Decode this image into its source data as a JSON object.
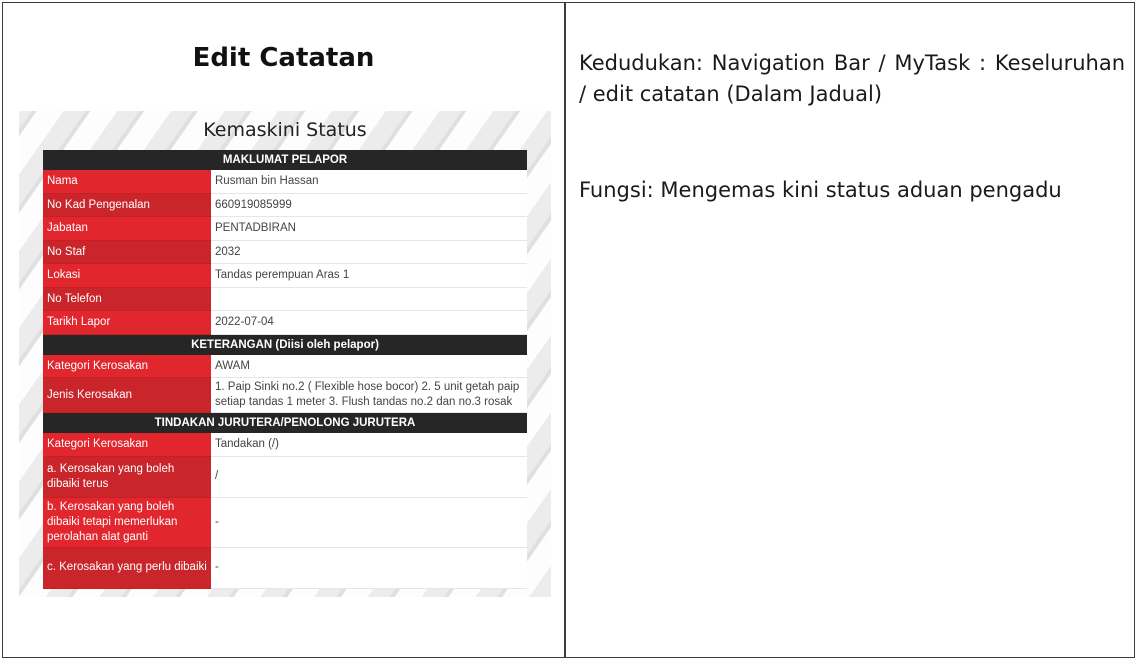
{
  "left": {
    "title": "Edit Catatan",
    "screenshot": {
      "heading": "Kemaskini Status",
      "sections": [
        {
          "header": "MAKLUMAT PELAPOR",
          "rows": [
            {
              "label": "Nama",
              "value": "Rusman bin Hassan"
            },
            {
              "label": "No Kad Pengenalan",
              "value": "660919085999"
            },
            {
              "label": "Jabatan",
              "value": "PENTADBIRAN"
            },
            {
              "label": "No Staf",
              "value": "2032"
            },
            {
              "label": "Lokasi",
              "value": "Tandas perempuan Aras 1"
            },
            {
              "label": "No Telefon",
              "value": ""
            },
            {
              "label": "Tarikh Lapor",
              "value": "2022-07-04"
            }
          ]
        },
        {
          "header": "KETERANGAN (Diisi oleh pelapor)",
          "rows": [
            {
              "label": "Kategori Kerosakan",
              "value": "AWAM"
            },
            {
              "label": "Jenis Kerosakan",
              "value": "1. Paip Sinki no.2 ( Flexible hose bocor) 2. 5 unit getah paip setiap tandas 1 meter 3. Flush tandas no.2 dan no.3 rosak"
            }
          ]
        },
        {
          "header": "TINDAKAN JURUTERA/PENOLONG JURUTERA",
          "rows": [
            {
              "label": "Kategori Kerosakan",
              "value": "Tandakan (/)"
            },
            {
              "label": "a. Kerosakan yang boleh dibaiki terus",
              "value": "/"
            },
            {
              "label": "b. Kerosakan yang boleh dibaiki tetapi memerlukan perolahan alat ganti",
              "value": "-"
            },
            {
              "label": "c. Kerosakan yang perlu dibaiki",
              "value": "-"
            }
          ]
        }
      ]
    }
  },
  "right": {
    "location": "Kedudukan: Navigation Bar / MyTask : Keseluruhan / edit catatan (Dalam Jadual)",
    "function": "Fungsi: Mengemas kini status aduan pengadu"
  }
}
